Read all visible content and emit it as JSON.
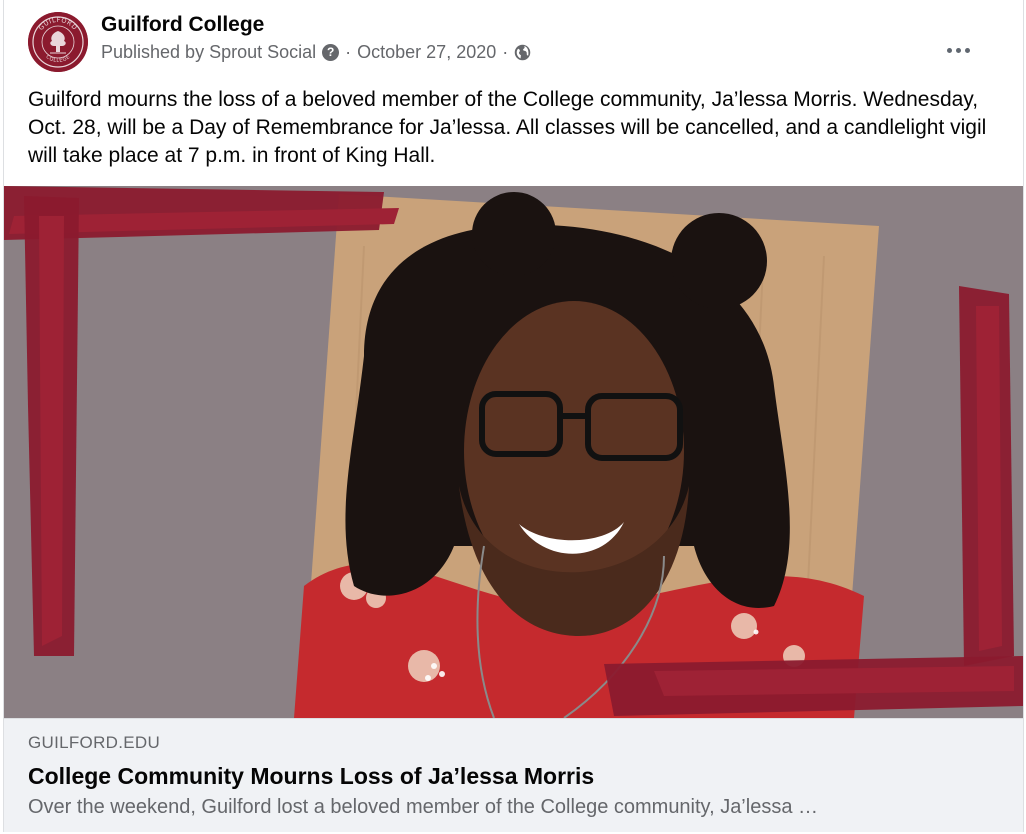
{
  "post": {
    "page_name": "Guilford College",
    "avatar_text_top": "GUILFORD",
    "avatar_text_bottom": "COLLEGE",
    "published_by": "Published by Sprout Social",
    "help_glyph": "?",
    "separator": "·",
    "date": "October 27, 2020",
    "audience_icon": "globe-icon",
    "more_icon": "more-options-icon",
    "text": "Guilford mourns the loss of a beloved member of the College community, Ja’lessa Morris. Wednesday, Oct. 28, will be a Day of Remembrance for Ja’lessa. All classes will be cancelled, and a candlelight vigil will take place at 7 p.m. in front of King Hall."
  },
  "link_preview": {
    "domain": "GUILFORD.EDU",
    "title": "College Community Mourns Loss of Ja’lessa Morris",
    "description": "Over the weekend, Guilford lost a beloved member of the College community, Ja’lessa …"
  },
  "colors": {
    "brand_maroon": "#8b1a2e",
    "image_background": "#8b8084",
    "link_box_background": "#f0f2f5",
    "secondary_text": "#65676b"
  }
}
